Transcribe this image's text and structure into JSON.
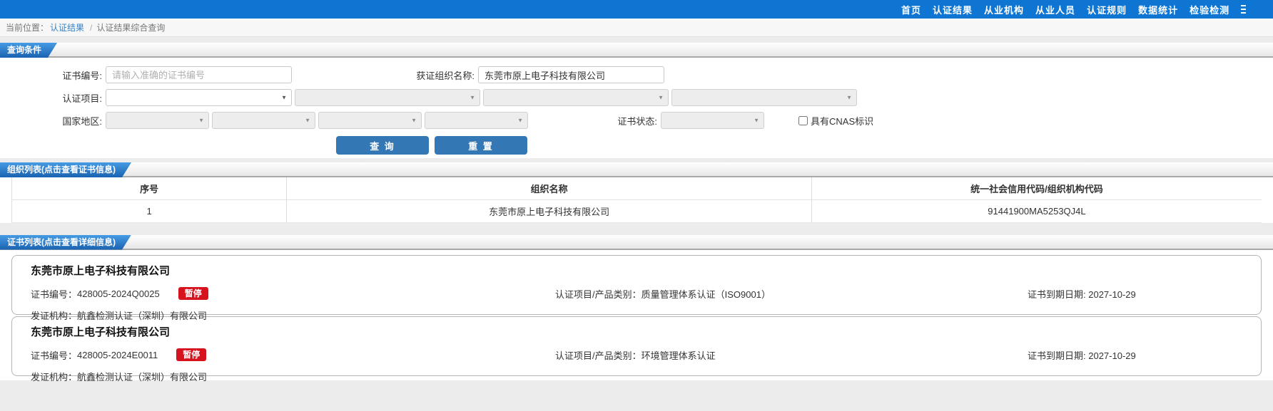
{
  "nav": {
    "items": [
      "首页",
      "认证结果",
      "从业机构",
      "从业人员",
      "认证规则",
      "数据统计",
      "检验检测"
    ]
  },
  "breadcrumb": {
    "prefix": "当前位置：",
    "link": "认证结果",
    "separator": "/",
    "current": "认证结果综合查询"
  },
  "query": {
    "section_title": "查询条件",
    "cert_no_label": "证书编号:",
    "cert_no_placeholder": "请输入准确的证书编号",
    "org_name_label": "获证组织名称:",
    "org_name_value": "东莞市原上电子科技有限公司",
    "project_label": "认证项目:",
    "region_label": "国家地区:",
    "status_label": "证书状态:",
    "cnas_label": "具有CNAS标识",
    "search_button": "查 询",
    "reset_button": "重 置"
  },
  "org_list": {
    "section_title": "组织列表(点击查看证书信息)",
    "columns": [
      "序号",
      "组织名称",
      "统一社会信用代码/组织机构代码"
    ],
    "rows": [
      {
        "index": "1",
        "name": "东莞市原上电子科技有限公司",
        "code": "91441900MA5253QJ4L"
      }
    ]
  },
  "cert_list": {
    "section_title": "证书列表(点击查看详细信息)",
    "labels": {
      "cert_no": "证书编号：",
      "project": "认证项目/产品类别：",
      "expire": "证书到期日期: ",
      "issuer": "发证机构："
    },
    "cards": [
      {
        "org": "东莞市原上电子科技有限公司",
        "cert_no": "428005-2024Q0025",
        "status": "暂停",
        "project": "质量管理体系认证（ISO9001）",
        "expire": "2027-10-29",
        "issuer": "航鑫检测认证（深圳）有限公司"
      },
      {
        "org": "东莞市原上电子科技有限公司",
        "cert_no": "428005-2024E0011",
        "status": "暂停",
        "project": "环境管理体系认证",
        "expire": "2027-10-29",
        "issuer": "航鑫检测认证（深圳）有限公司"
      }
    ]
  },
  "colors": {
    "nav_blue": "#0e75d3",
    "tab_blue": "#1a62b0",
    "button_blue": "#3377b5",
    "badge_red": "#d6121e",
    "link_blue": "#3a82c4"
  }
}
